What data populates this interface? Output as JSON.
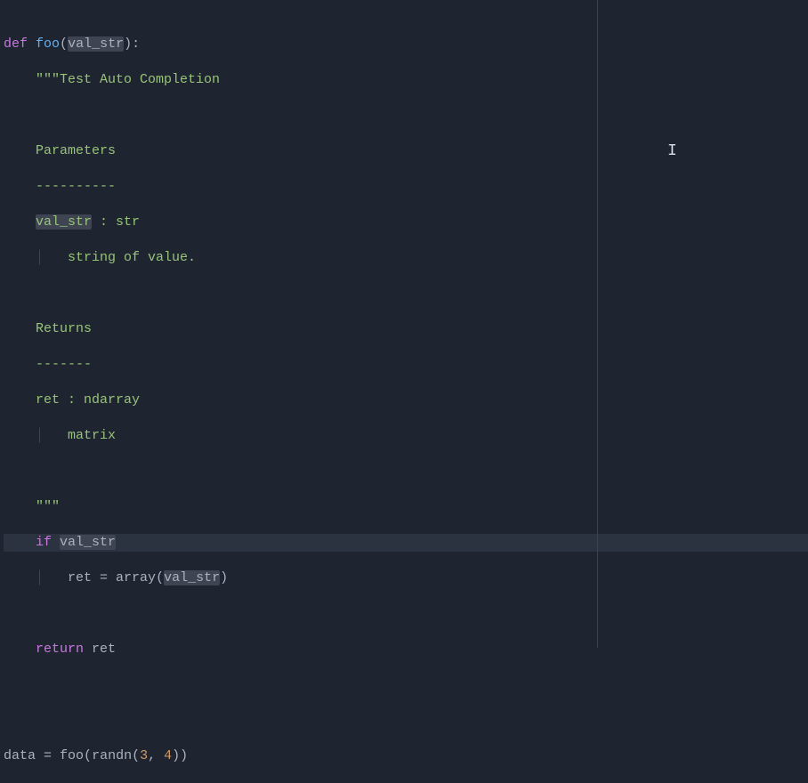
{
  "code": {
    "line1": {
      "def": "def",
      "fn": "foo",
      "open": "(",
      "arg": "val_str",
      "close": "):"
    },
    "line2": {
      "indent": "    ",
      "text": "\"\"\"Test Auto Completion"
    },
    "line3": "",
    "line4": {
      "indent": "    ",
      "text": "Parameters"
    },
    "line5": {
      "indent": "    ",
      "text": "----------"
    },
    "line6": {
      "indent": "    ",
      "var": "val_str",
      "rest": " : str"
    },
    "line7": {
      "guide": "    |   ",
      "text": "string of value."
    },
    "line8": "",
    "line9": {
      "indent": "    ",
      "text": "Returns"
    },
    "line10": {
      "indent": "    ",
      "text": "-------"
    },
    "line11": {
      "indent": "    ",
      "text": "ret : ndarray"
    },
    "line12": {
      "guide": "    |   ",
      "text": "matrix"
    },
    "line13": "",
    "line14": {
      "indent": "    ",
      "text": "\"\"\""
    },
    "line15": {
      "indent": "    ",
      "if": "if",
      "sp": " ",
      "var": "val_str"
    },
    "line16": {
      "guide": "    |   ",
      "lhs": "ret ",
      "eq": "= ",
      "fn": "array",
      "open": "(",
      "arg": "val_str",
      "close": ")"
    },
    "line17": "",
    "line18": {
      "indent": "    ",
      "return": "return",
      "sp": " ",
      "var": "ret"
    },
    "line19": "",
    "line20": "",
    "line21": {
      "lhs": "data ",
      "eq": "= ",
      "fn1": "foo",
      "open1": "(",
      "fn2": "randn",
      "open2": "(",
      "n1": "3",
      "comma": ", ",
      "n2": "4",
      "close": "))"
    }
  },
  "cursor_glyph": "I"
}
